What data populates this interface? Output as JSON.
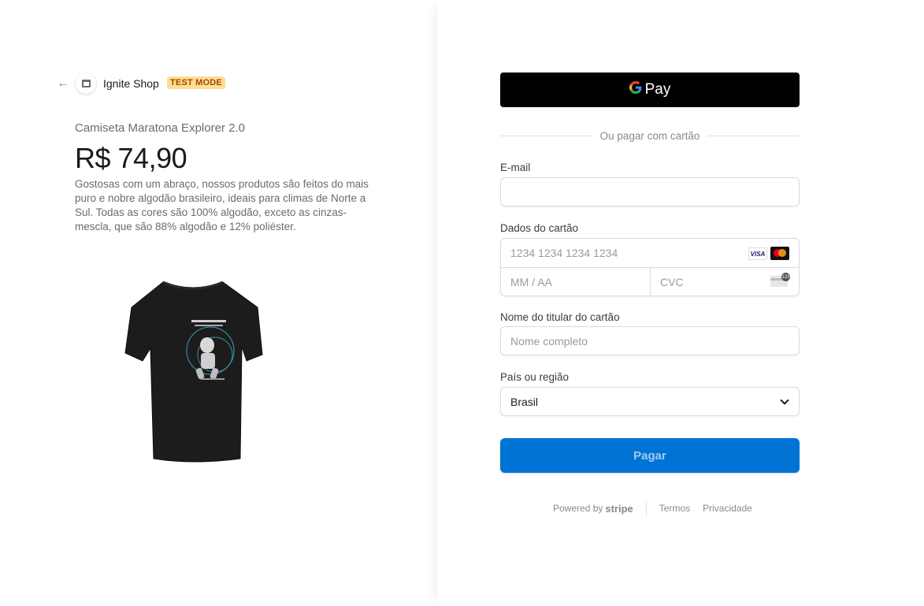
{
  "header": {
    "shop_name": "Ignite Shop",
    "test_badge": "TEST MODE"
  },
  "product": {
    "name": "Camiseta Maratona Explorer 2.0",
    "price": "R$ 74,90",
    "description": "Gostosas com um abraço, nossos produtos são feitos do mais puro e nobre algodão brasileiro, ideais para climas de Norte a Sul. Todas as cores são 100% algodão, exceto as cinzas-mescla, que são 88% algodão e 12% poliéster.",
    "image_icon": "tshirt-image"
  },
  "payment": {
    "gpay_label": "Pay",
    "gpay_g": "G",
    "divider_text": "Ou pagar com cartão",
    "email_label": "E-mail",
    "email_value": "",
    "card_label": "Dados do cartão",
    "card_number_placeholder": "1234 1234 1234 1234",
    "card_exp_placeholder": "MM / AA",
    "card_cvc_placeholder": "CVC",
    "visa_text": "VISA",
    "cvc_badge": "123",
    "holder_label": "Nome do titular do cartão",
    "holder_placeholder": "Nome completo",
    "country_label": "País ou região",
    "country_value": "Brasil",
    "pay_button": "Pagar"
  },
  "footer": {
    "powered_by": "Powered by",
    "stripe": "stripe",
    "terms": "Termos",
    "privacy": "Privacidade"
  },
  "colors": {
    "pay_button_bg": "#0074d4",
    "test_badge_bg": "#ffde92",
    "gpay_bg": "#000000"
  }
}
